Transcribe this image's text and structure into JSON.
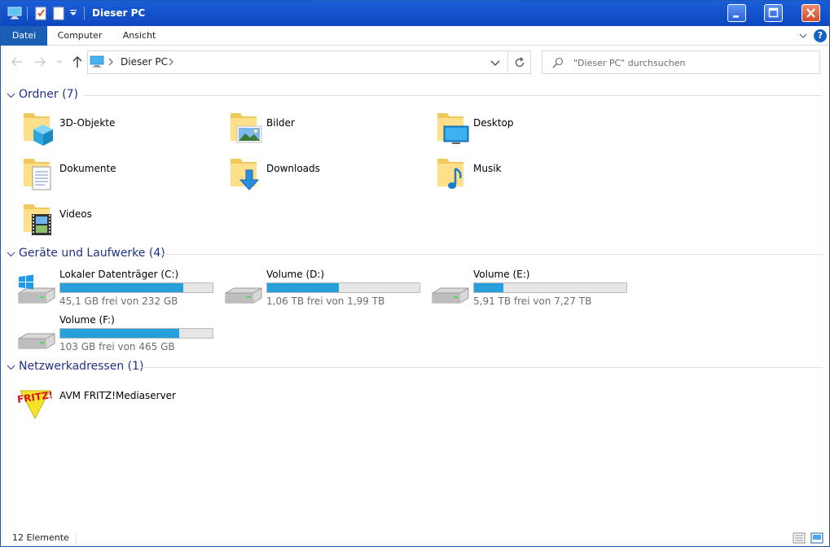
{
  "window": {
    "title": "Dieser PC"
  },
  "ribbon": {
    "tabs": [
      "Datei",
      "Computer",
      "Ansicht"
    ],
    "help": "?"
  },
  "address": {
    "location": "Dieser PC"
  },
  "search": {
    "placeholder": "\"Dieser PC\" durchsuchen"
  },
  "groups": {
    "folders": {
      "title": "Ordner (7)"
    },
    "drives": {
      "title": "Geräte und Laufwerke (4)"
    },
    "network": {
      "title": "Netzwerkadressen (1)"
    }
  },
  "folders": [
    {
      "label": "3D-Objekte",
      "icon": "3d-objects-folder-icon"
    },
    {
      "label": "Bilder",
      "icon": "pictures-folder-icon"
    },
    {
      "label": "Desktop",
      "icon": "desktop-folder-icon"
    },
    {
      "label": "Dokumente",
      "icon": "documents-folder-icon"
    },
    {
      "label": "Downloads",
      "icon": "downloads-folder-icon"
    },
    {
      "label": "Musik",
      "icon": "music-folder-icon"
    },
    {
      "label": "Videos",
      "icon": "videos-folder-icon"
    }
  ],
  "drives": [
    {
      "name": "Lokaler Datenträger (C:)",
      "free": "45,1 GB frei von 232 GB",
      "used_fraction": 0.81,
      "icon": "windows-drive-icon"
    },
    {
      "name": "Volume (D:)",
      "free": "1,06 TB frei von 1,99 TB",
      "used_fraction": 0.47,
      "icon": "hard-drive-icon"
    },
    {
      "name": "Volume (E:)",
      "free": "5,91 TB frei von 7,27 TB",
      "used_fraction": 0.19,
      "icon": "hard-drive-icon"
    },
    {
      "name": "Volume (F:)",
      "free": "103 GB frei von 465 GB",
      "used_fraction": 0.78,
      "icon": "hard-drive-icon"
    }
  ],
  "network": [
    {
      "label": "AVM FRITZ!Mediaserver",
      "icon": "fritz-logo-icon"
    }
  ],
  "status": {
    "count": "12 Elemente"
  },
  "colors": {
    "titlebar": "#0d47c0",
    "file_tab": "#1a5fb4",
    "group_title": "#1e3287",
    "drive_bar": "#26a0da"
  }
}
